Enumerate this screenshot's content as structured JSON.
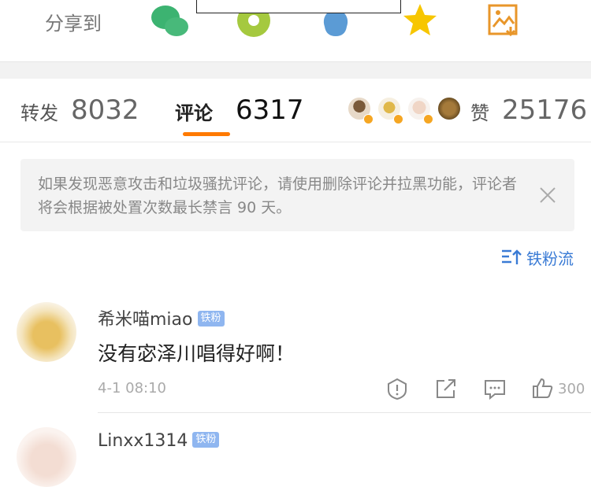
{
  "share": {
    "label": "分享到",
    "targets": [
      {
        "icon": "wechat-icon",
        "color": "#3cb371"
      },
      {
        "icon": "moments-icon",
        "color": "#9acd32"
      },
      {
        "icon": "qq-icon",
        "color": "#4a90e2"
      },
      {
        "icon": "favorite-star-icon",
        "color": "#f7c600"
      },
      {
        "icon": "save-image-icon",
        "color": "#e89a2c"
      }
    ]
  },
  "tabs": {
    "repost_label": "转发",
    "repost_count": "8032",
    "comment_label": "评论",
    "comment_count": "6317",
    "like_label": "赞",
    "like_count": "25176",
    "accent_color": "#ff7a00"
  },
  "notice": {
    "text": "如果发现恶意攻击和垃圾骚扰评论，请使用删除评论并拉黑功能，评论者将会根据被处置次数最长禁言 90 天。"
  },
  "sort": {
    "label": "铁粉流",
    "color": "#3a7bd5"
  },
  "comments": [
    {
      "username": "希米喵miao",
      "badge": "铁粉",
      "text": "没有宓泽川唱得好啊！",
      "time": "4-1 08:10",
      "likes": "300"
    },
    {
      "username": "Linxx1314",
      "badge": "铁粉"
    }
  ]
}
